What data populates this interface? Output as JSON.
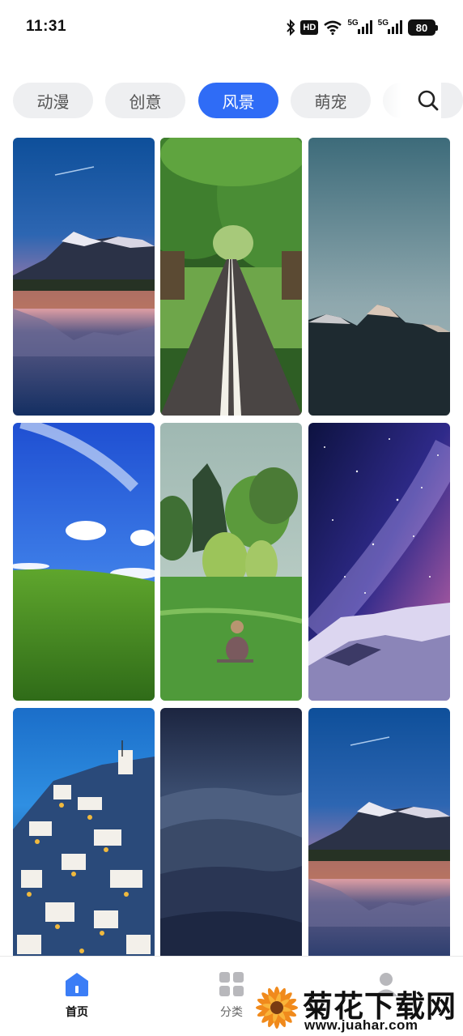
{
  "status_bar": {
    "time": "11:31",
    "hd": "HD",
    "network_1": "5G",
    "network_2": "5G",
    "battery": "80"
  },
  "tabs": [
    {
      "label": "动漫",
      "active": false
    },
    {
      "label": "创意",
      "active": false
    },
    {
      "label": "风景",
      "active": true
    },
    {
      "label": "萌宠",
      "active": false
    }
  ],
  "wallpapers": [
    {
      "icon": "mountain-lake-dusk"
    },
    {
      "icon": "tree-lined-road"
    },
    {
      "icon": "mountain-peaks-mist"
    },
    {
      "icon": "green-hill-blue-sky"
    },
    {
      "icon": "woman-sitting-in-meadow"
    },
    {
      "icon": "milky-way-snowy-mountain"
    },
    {
      "icon": "santorini-night-village"
    },
    {
      "icon": "night-sand-dunes"
    },
    {
      "icon": "mountain-lake-dusk"
    }
  ],
  "bottom_nav": {
    "home_label": "首页",
    "category_label": "分类"
  },
  "watermark": {
    "title": "菊花下载网",
    "url": "www.juahar.com"
  },
  "colors": {
    "accent": "#2f6cf6",
    "tab_bg": "#eeeff1"
  }
}
